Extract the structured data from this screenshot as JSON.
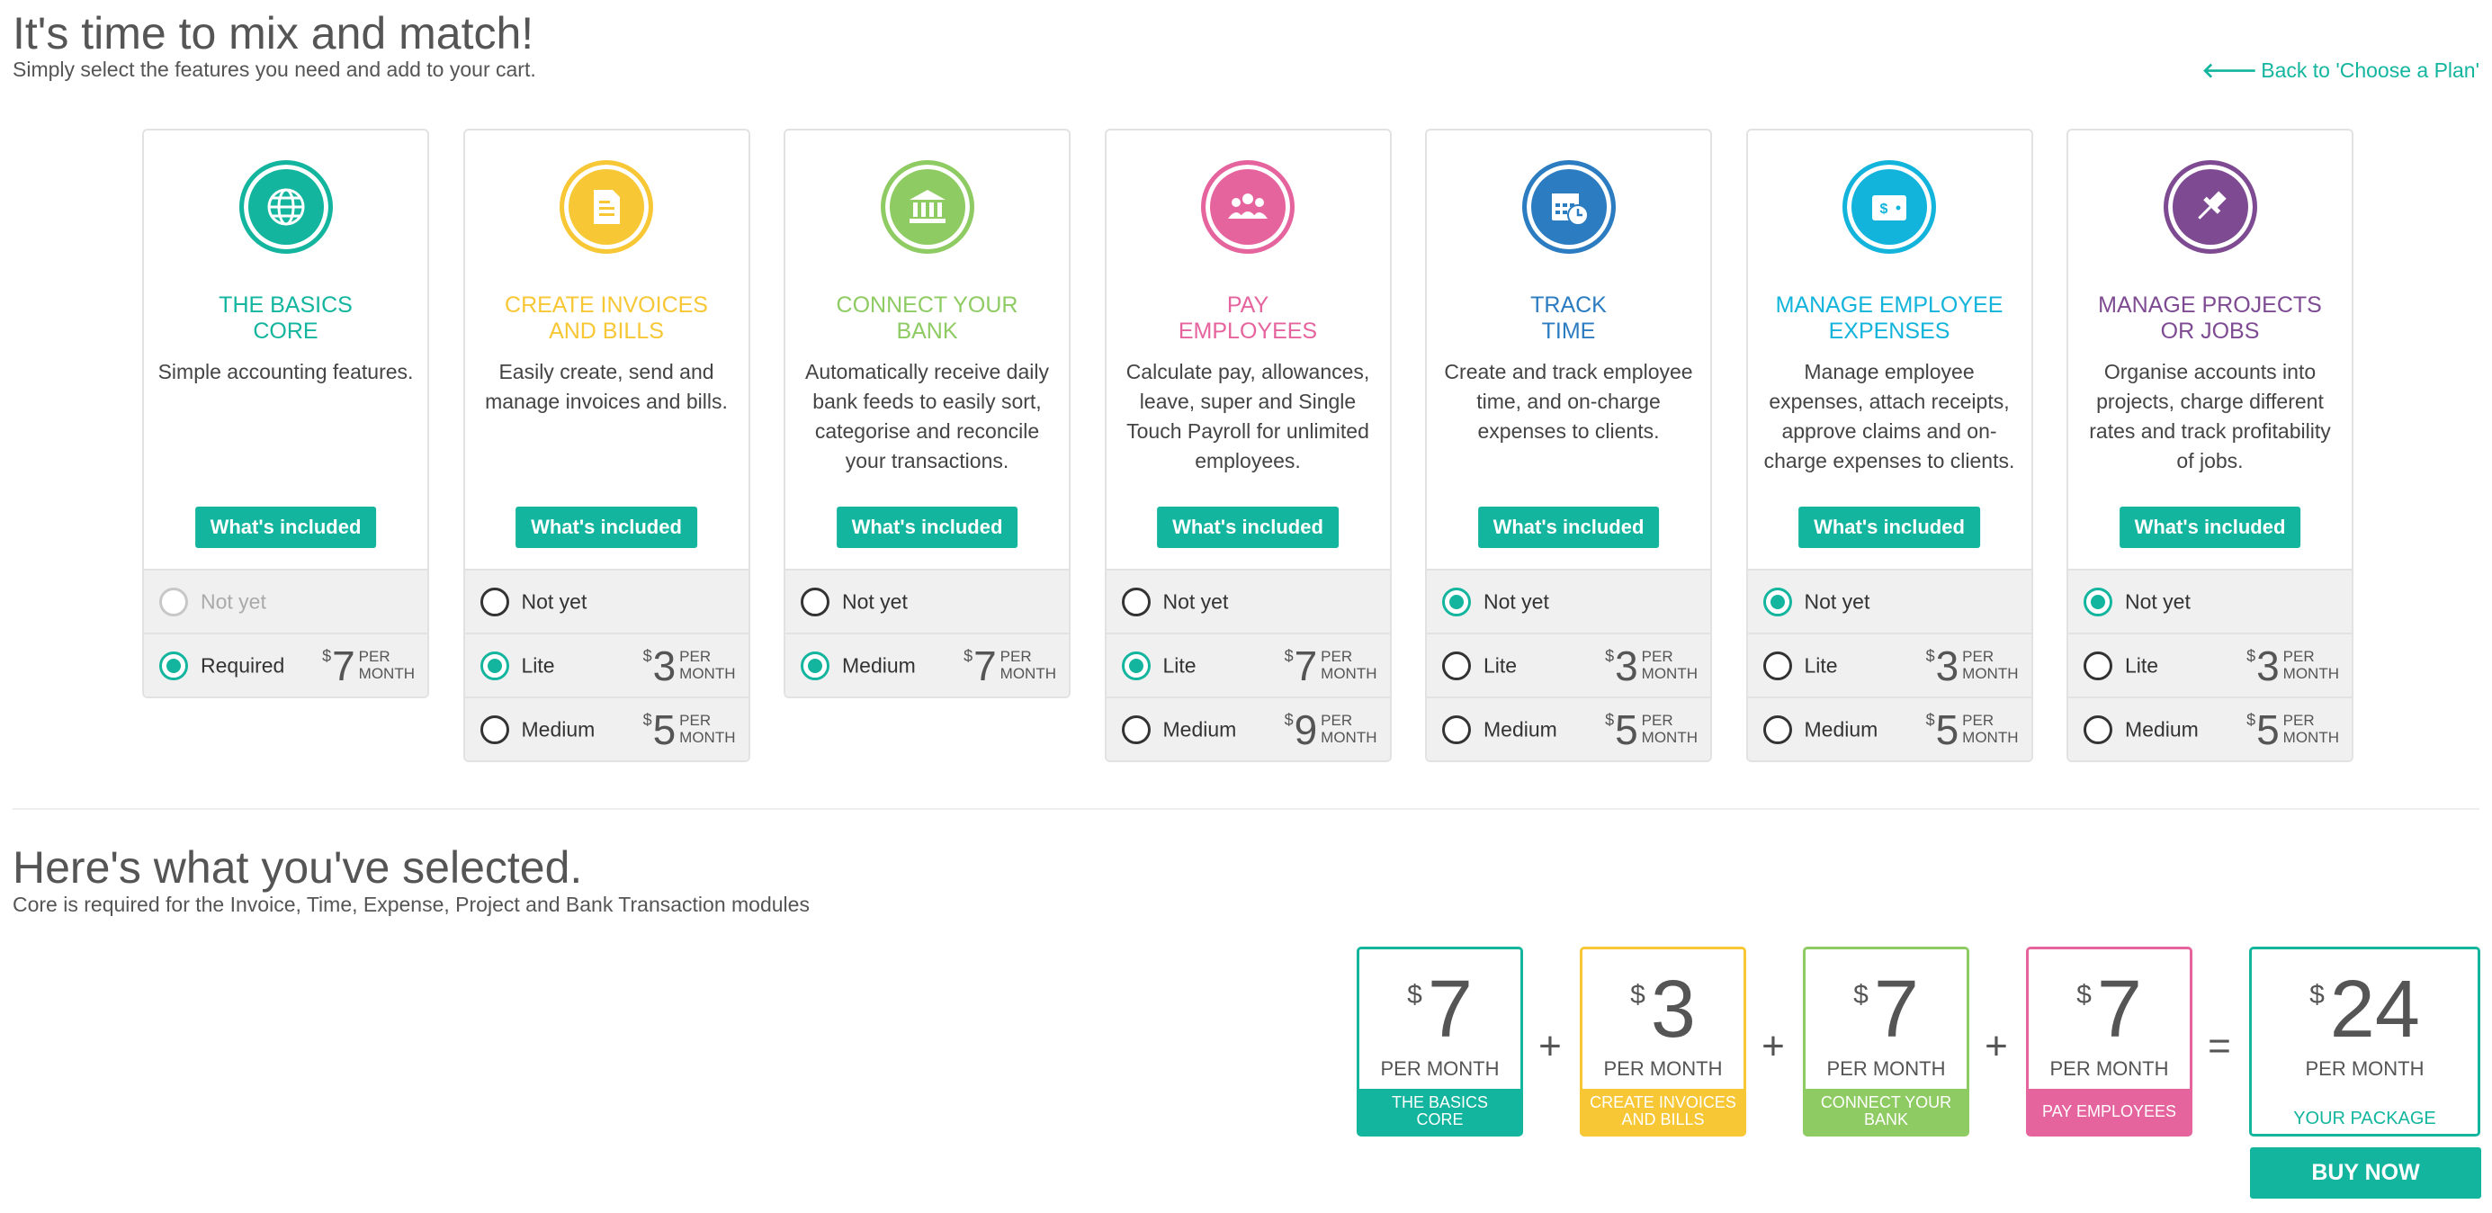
{
  "header": {
    "title": "It's time to mix and match!",
    "subtitle": "Simply select the features you need and add to your cart.",
    "back_link": "Back to 'Choose a Plan'"
  },
  "colors": {
    "accent": "#13b59e",
    "teal": "#13b59e",
    "yellow": "#f7c735",
    "green": "#8fcb63",
    "pink": "#e6649e",
    "blue": "#2c7cc1",
    "cyan": "#13b4dc",
    "purple": "#7e4b93"
  },
  "cards": [
    {
      "title_line1": "THE BASICS",
      "title_line2": "CORE",
      "description": "Simple accounting features.",
      "icon": "globe-icon",
      "color": "#13b59e",
      "button": "What's included",
      "options": [
        {
          "label": "Not yet",
          "state": "disabled",
          "price": ""
        },
        {
          "label": "Required",
          "state": "selected",
          "price": "7"
        }
      ]
    },
    {
      "title_line1": "CREATE INVOICES",
      "title_line2": "AND BILLS",
      "description": "Easily create, send and manage invoices and bills.",
      "icon": "invoice-icon",
      "color": "#f7c735",
      "button": "What's included",
      "options": [
        {
          "label": "Not yet",
          "state": "unselected",
          "price": ""
        },
        {
          "label": "Lite",
          "state": "selected",
          "price": "3"
        },
        {
          "label": "Medium",
          "state": "unselected",
          "price": "5"
        }
      ]
    },
    {
      "title_line1": "CONNECT YOUR",
      "title_line2": "BANK",
      "description": "Automatically receive daily bank feeds to easily sort, categorise and reconcile your transactions.",
      "icon": "bank-icon",
      "color": "#8fcb63",
      "button": "What's included",
      "options": [
        {
          "label": "Not yet",
          "state": "unselected",
          "price": ""
        },
        {
          "label": "Medium",
          "state": "selected",
          "price": "7"
        }
      ]
    },
    {
      "title_line1": "PAY",
      "title_line2": "EMPLOYEES",
      "description": "Calculate pay, allowances, leave, super and Single Touch Payroll for unlimited employees.",
      "icon": "people-icon",
      "color": "#e6649e",
      "button": "What's included",
      "options": [
        {
          "label": "Not yet",
          "state": "unselected",
          "price": ""
        },
        {
          "label": "Lite",
          "state": "selected",
          "price": "7"
        },
        {
          "label": "Medium",
          "state": "unselected",
          "price": "9"
        }
      ]
    },
    {
      "title_line1": "TRACK",
      "title_line2": "TIME",
      "description": "Create and track employee time, and on-charge expenses to clients.",
      "icon": "calendar-clock-icon",
      "color": "#2c7cc1",
      "button": "What's included",
      "options": [
        {
          "label": "Not yet",
          "state": "selected",
          "price": ""
        },
        {
          "label": "Lite",
          "state": "unselected",
          "price": "3"
        },
        {
          "label": "Medium",
          "state": "unselected",
          "price": "5"
        }
      ]
    },
    {
      "title_line1": "MANAGE EMPLOYEE",
      "title_line2": "EXPENSES",
      "description": "Manage employee expenses, attach receipts, approve claims and on-charge expenses to clients.",
      "icon": "wallet-icon",
      "color": "#13b4dc",
      "button": "What's included",
      "options": [
        {
          "label": "Not yet",
          "state": "selected",
          "price": ""
        },
        {
          "label": "Lite",
          "state": "unselected",
          "price": "3"
        },
        {
          "label": "Medium",
          "state": "unselected",
          "price": "5"
        }
      ]
    },
    {
      "title_line1": "MANAGE PROJECTS",
      "title_line2": "OR JOBS",
      "description": "Organise accounts into projects, charge different rates and track profitability of jobs.",
      "icon": "pushpin-icon",
      "color": "#7e4b93",
      "button": "What's included",
      "options": [
        {
          "label": "Not yet",
          "state": "selected",
          "price": ""
        },
        {
          "label": "Lite",
          "state": "unselected",
          "price": "3"
        },
        {
          "label": "Medium",
          "state": "unselected",
          "price": "5"
        }
      ]
    }
  ],
  "price_currency": "$",
  "price_per_line1": "PER",
  "price_per_line2": "MONTH",
  "selection": {
    "title": "Here's what you've selected.",
    "subtitle": "Core is required for the Invoice, Time, Expense, Project and Bank Transaction modules",
    "items": [
      {
        "price": "7",
        "label": "THE BASICS CORE",
        "color": "#13b59e"
      },
      {
        "price": "3",
        "label": "CREATE INVOICES AND BILLS",
        "color": "#f7c735"
      },
      {
        "price": "7",
        "label": "CONNECT YOUR BANK",
        "color": "#8fcb63"
      },
      {
        "price": "7",
        "label": "PAY EMPLOYEES",
        "color": "#e6649e"
      }
    ],
    "per_month": "PER MONTH",
    "plus": "+",
    "equals": "=",
    "total": {
      "price": "24",
      "label": "YOUR PACKAGE"
    },
    "buy_button": "BUY NOW"
  }
}
